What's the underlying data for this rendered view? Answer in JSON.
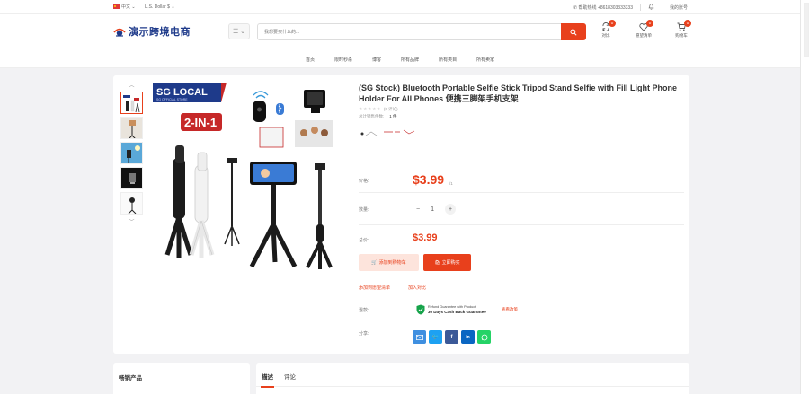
{
  "topbar": {
    "language": "中文",
    "currency": "U.S. Dollar $",
    "phone": "帮助热线 +8618303333333",
    "account": "我的账号"
  },
  "header": {
    "logo_text": "演示跨境电商",
    "search_placeholder": "我想要买什么的...",
    "compare": {
      "label": "对比",
      "count": "0"
    },
    "wishlist": {
      "label": "愿望清单",
      "count": "0"
    },
    "cart": {
      "label": "购物车",
      "count": "0"
    }
  },
  "nav": {
    "items": [
      "首页",
      "限时秒杀",
      "博客",
      "所有品牌",
      "所有类目",
      "所有卖家"
    ]
  },
  "product": {
    "title": "(SG Stock) Bluetooth Portable Selfie Stick Tripod Stand Selfie with Fill Light Phone Holder For All Phones 便携三脚架手机支架",
    "rating_text": "(0 评论)",
    "stars": "★★★★★",
    "sold_label": "总计销售件数:",
    "sold_value": "1 件",
    "price_label": "价格:",
    "price": "$3.99",
    "price_unit": "/1",
    "qty_label": "数量:",
    "qty": "1",
    "total_label": "总价:",
    "total": "$3.99",
    "add_to_cart": "添加到购物车",
    "buy_now": "立即购买",
    "add_wishlist": "添加到愿望清单",
    "add_compare": "加入对比",
    "guarantee_label": "退款:",
    "guarantee_line1": "Refund Guarantee with Product",
    "guarantee_line2": "30 Days Cash Back Guarantee",
    "guarantee_more": "查看政策",
    "share_label": "分享:",
    "image_brand": "SG LOCAL",
    "image_sub": "SG OFFICIAL STORE",
    "image_tag": "2-IN-1"
  },
  "bottom": {
    "sidebar_title": "畅销产品",
    "tabs": [
      "描述",
      "评论"
    ]
  },
  "colors": {
    "accent": "#e8401c",
    "brand_blue": "#1e3a8a"
  }
}
